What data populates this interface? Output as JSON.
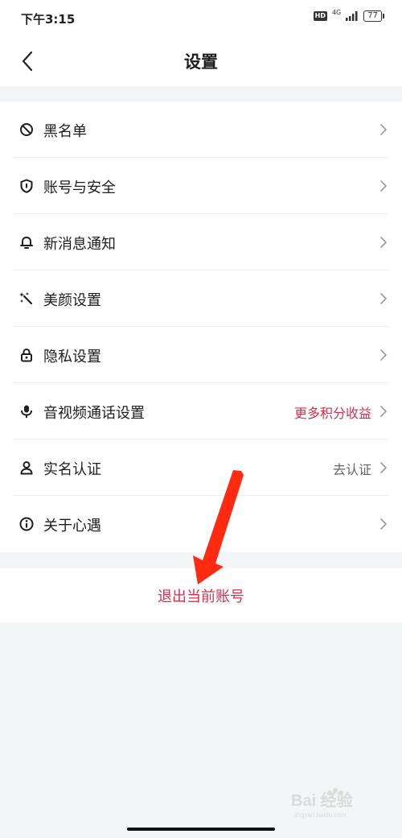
{
  "status_bar": {
    "time": "下午3:15",
    "hd_badge": "HD",
    "network": "4G",
    "battery": "77"
  },
  "header": {
    "title": "设置",
    "back_icon": "chevron-left-icon"
  },
  "settings": {
    "items": [
      {
        "label": "黑名单",
        "value": "",
        "icon": "block-icon"
      },
      {
        "label": "账号与安全",
        "value": "",
        "icon": "shield-icon"
      },
      {
        "label": "新消息通知",
        "value": "",
        "icon": "bell-icon"
      },
      {
        "label": "美颜设置",
        "value": "",
        "icon": "magic-wand-icon"
      },
      {
        "label": "隐私设置",
        "value": "",
        "icon": "lock-icon"
      },
      {
        "label": "音视频通话设置",
        "value": "更多积分收益",
        "icon": "microphone-icon"
      },
      {
        "label": "实名认证",
        "value": "去认证",
        "icon": "person-icon"
      },
      {
        "label": "关于心遇",
        "value": "",
        "icon": "info-icon"
      }
    ]
  },
  "logout": {
    "label": "退出当前账号"
  },
  "watermark": {
    "text": "Bai 经验",
    "url_text": "jingyan.baidu.com"
  },
  "colors": {
    "accent": "#d62f4e",
    "background": "#f3f6f6",
    "arrow": "#ff2a10"
  }
}
